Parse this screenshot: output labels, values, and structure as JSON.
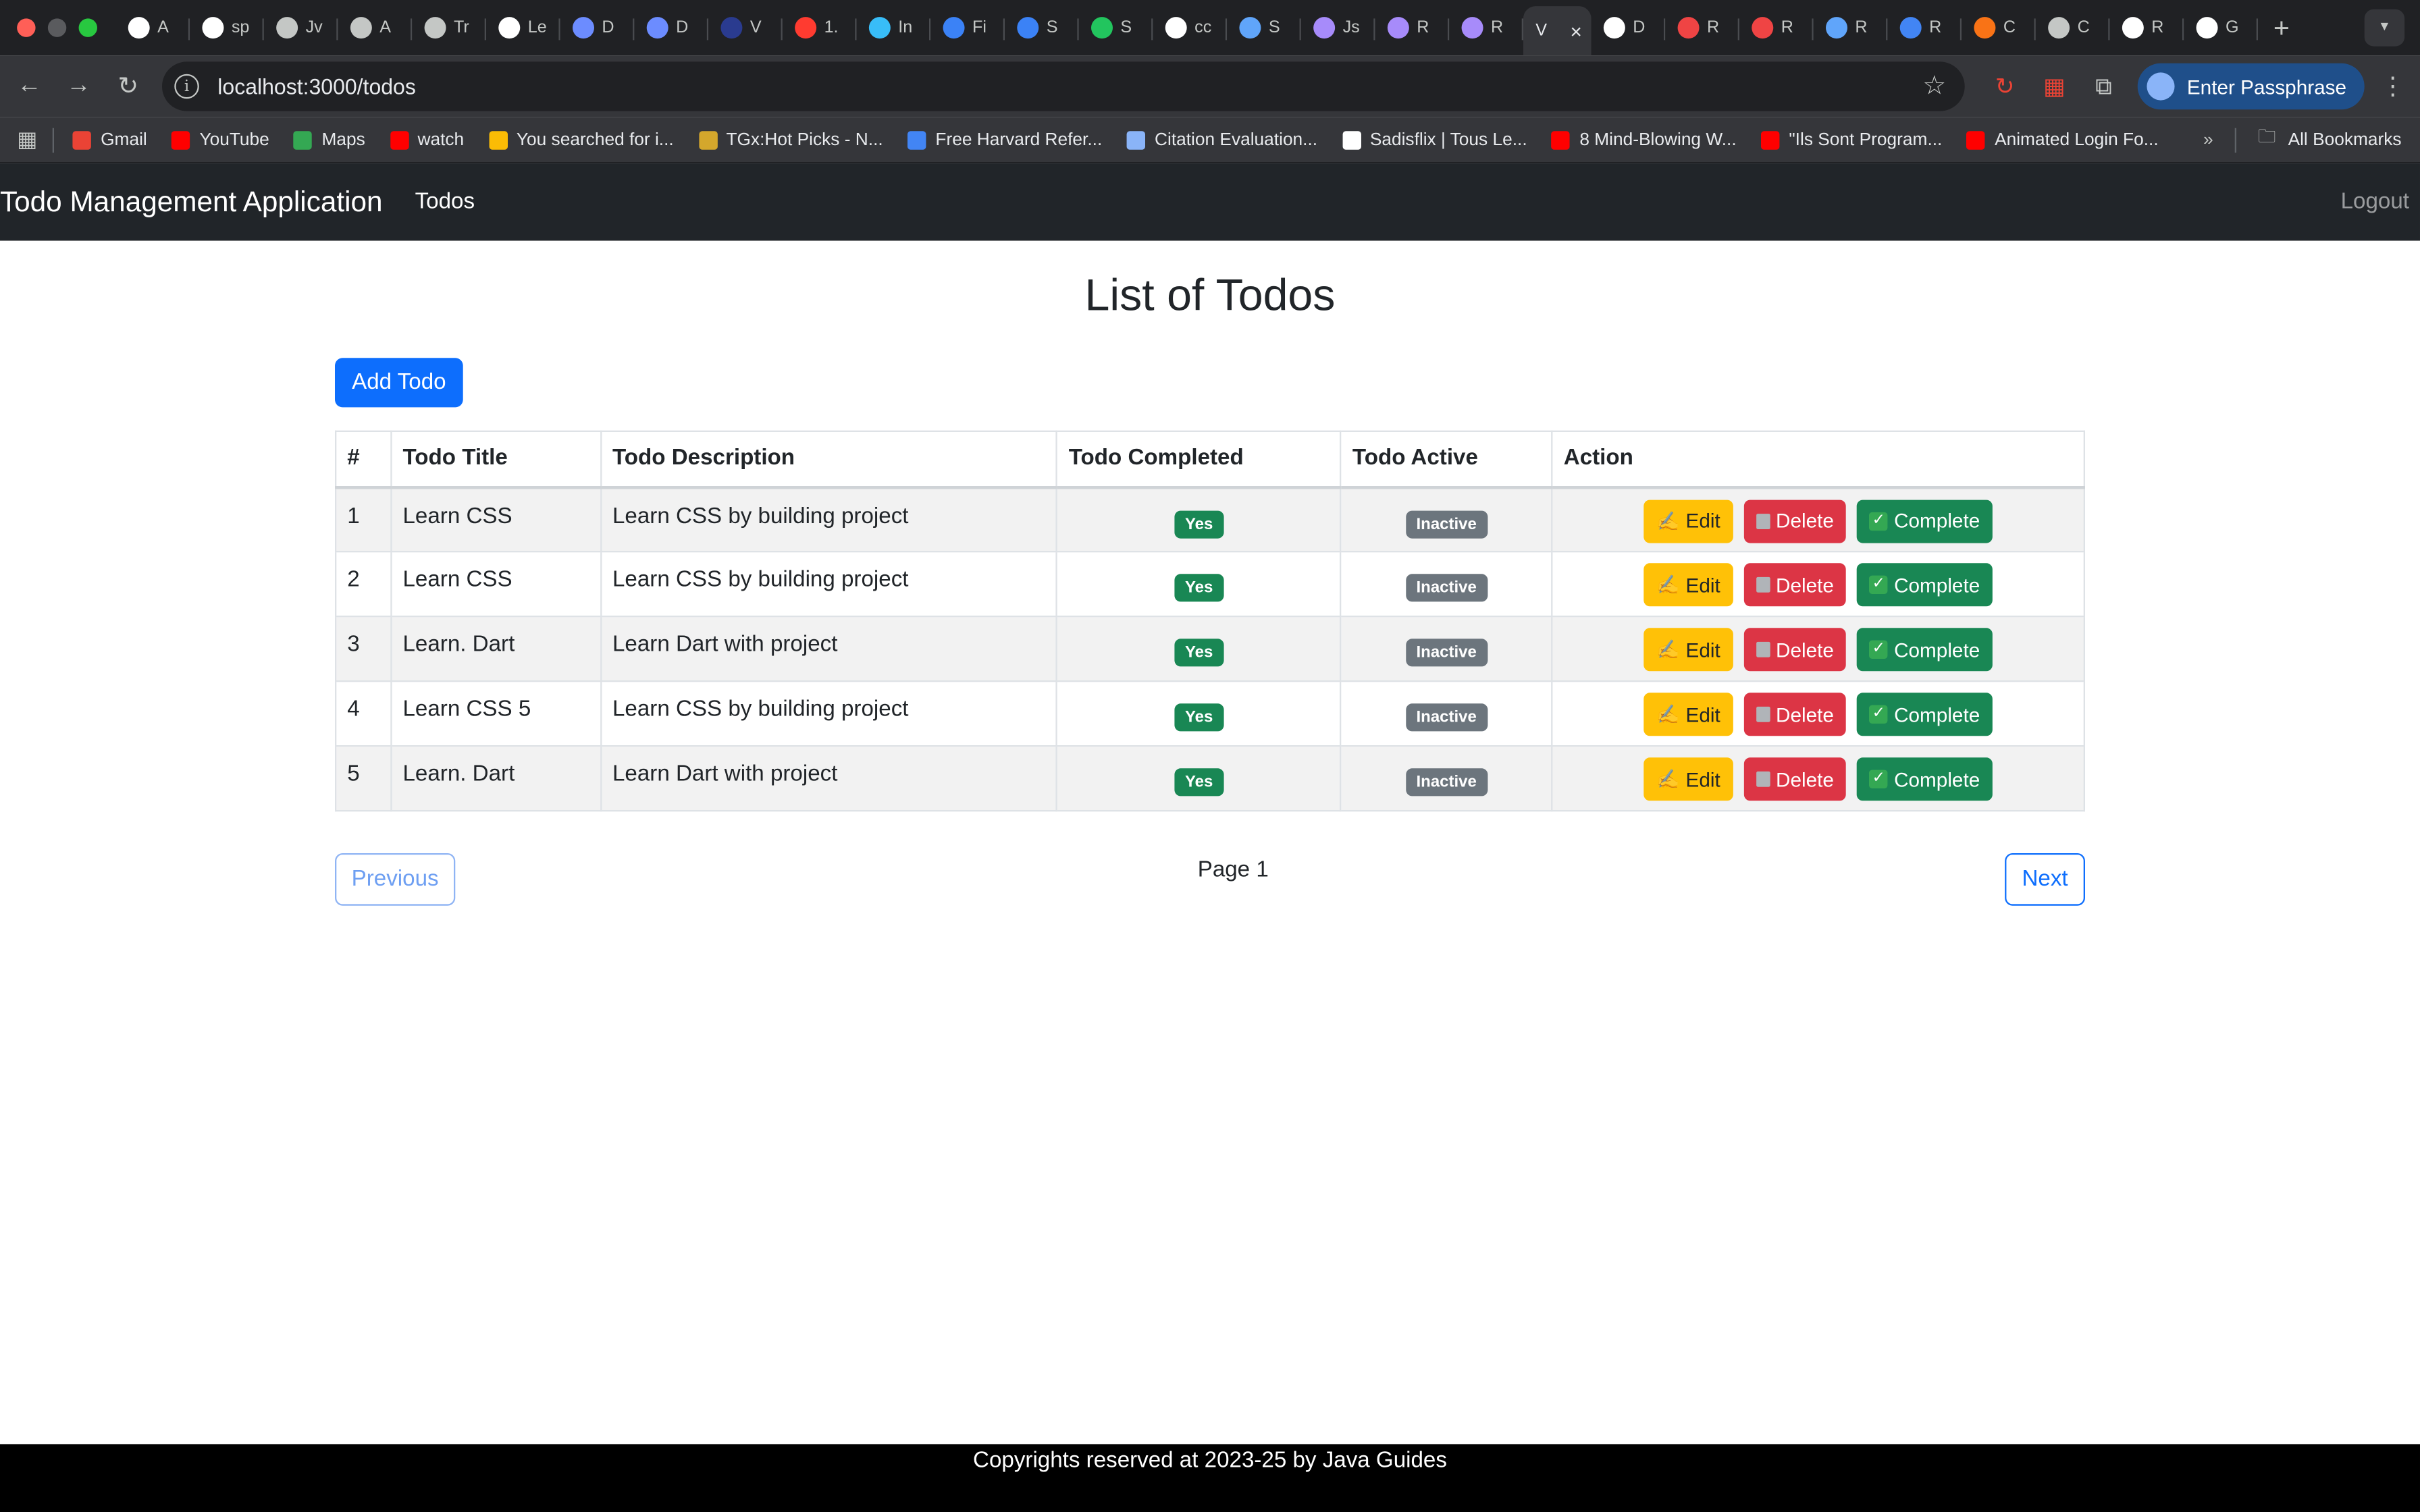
{
  "browser": {
    "tabs": [
      {
        "label": "A",
        "color": "#ffffff"
      },
      {
        "label": "sp",
        "color": "#ffffff"
      },
      {
        "label": "Jv",
        "color": "#c4c7c5"
      },
      {
        "label": "A",
        "color": "#c4c7c5"
      },
      {
        "label": "Tr",
        "color": "#c4c7c5"
      },
      {
        "label": "Le",
        "color": "#ffffff"
      },
      {
        "label": "D",
        "color": "#6c8cff"
      },
      {
        "label": "D",
        "color": "#6c8cff"
      },
      {
        "label": "V",
        "color": "#2a3b8f"
      },
      {
        "label": "1.",
        "color": "#ff3b30"
      },
      {
        "label": "In",
        "color": "#38bdf8"
      },
      {
        "label": "Fi",
        "color": "#3b82f6"
      },
      {
        "label": "S",
        "color": "#3b82f6"
      },
      {
        "label": "S",
        "color": "#22c55e"
      },
      {
        "label": "cc",
        "color": "#ffffff"
      },
      {
        "label": "S",
        "color": "#60a5fa"
      },
      {
        "label": "Js",
        "color": "#a78bfa"
      },
      {
        "label": "R",
        "color": "#a78bfa"
      },
      {
        "label": "R",
        "color": "#a78bfa"
      },
      {
        "label": "D",
        "color": "#ffffff"
      },
      {
        "label": "R",
        "color": "#ef4444"
      },
      {
        "label": "R",
        "color": "#ef4444"
      },
      {
        "label": "R",
        "color": "#60a5fa"
      },
      {
        "label": "R",
        "color": "#4285f4"
      },
      {
        "label": "C",
        "color": "#f97316"
      },
      {
        "label": "C",
        "color": "#c4c7c5"
      },
      {
        "label": "R",
        "color": "#ffffff"
      },
      {
        "label": "G",
        "color": "#ffffff"
      }
    ],
    "active_tab": {
      "label": "V",
      "close": "×"
    },
    "url": "localhost:3000/todos",
    "pass_button": "Enter Passphrase",
    "bookmarks": [
      {
        "label": "Gmail",
        "color": "#ea4335"
      },
      {
        "label": "YouTube",
        "color": "#ff0000"
      },
      {
        "label": "Maps",
        "color": "#34a853"
      },
      {
        "label": "watch",
        "color": "#ff0000"
      },
      {
        "label": "You searched for i...",
        "color": "#fbbc05"
      },
      {
        "label": "TGx:Hot Picks - N...",
        "color": "#d4a72c"
      },
      {
        "label": "Free Harvard Refer...",
        "color": "#4285f4"
      },
      {
        "label": "Citation Evaluation...",
        "color": "#8ab4f8"
      },
      {
        "label": "Sadisflix | Tous Le...",
        "color": "#ffffff"
      },
      {
        "label": "8 Mind-Blowing W...",
        "color": "#ff0000"
      },
      {
        "label": "\"Ils Sont Program...",
        "color": "#ff0000"
      },
      {
        "label": "Animated Login Fo...",
        "color": "#ff0000"
      }
    ],
    "all_bookmarks": "All Bookmarks"
  },
  "app": {
    "brand": "Todo Management Application",
    "nav_todos": "Todos",
    "logout": "Logout",
    "title": "List of Todos",
    "add_button": "Add Todo",
    "columns": [
      "#",
      "Todo Title",
      "Todo Description",
      "Todo Completed",
      "Todo Active",
      "Action"
    ],
    "rows": [
      {
        "id": "1",
        "title": "Learn CSS",
        "description": "Learn CSS by building project",
        "completed": "Yes",
        "active": "Inactive"
      },
      {
        "id": "2",
        "title": "Learn CSS",
        "description": "Learn CSS by building project",
        "completed": "Yes",
        "active": "Inactive"
      },
      {
        "id": "3",
        "title": "Learn. Dart",
        "description": "Learn Dart with project",
        "completed": "Yes",
        "active": "Inactive"
      },
      {
        "id": "4",
        "title": "Learn CSS 5",
        "description": "Learn CSS by building project",
        "completed": "Yes",
        "active": "Inactive"
      },
      {
        "id": "5",
        "title": "Learn. Dart",
        "description": "Learn Dart with project",
        "completed": "Yes",
        "active": "Inactive"
      }
    ],
    "actions": {
      "edit": "Edit",
      "delete": "Delete",
      "complete": "Complete"
    },
    "pager": {
      "previous": "Previous",
      "label": "Page 1",
      "next": "Next"
    },
    "footer": "Copyrights reserved at 2023-25 by Java Guides"
  },
  "colors": {
    "navbar": "#212529",
    "primary": "#0d6efd",
    "success": "#198754",
    "warning": "#ffc107",
    "danger": "#dc3545",
    "secondary": "#6c757d"
  }
}
